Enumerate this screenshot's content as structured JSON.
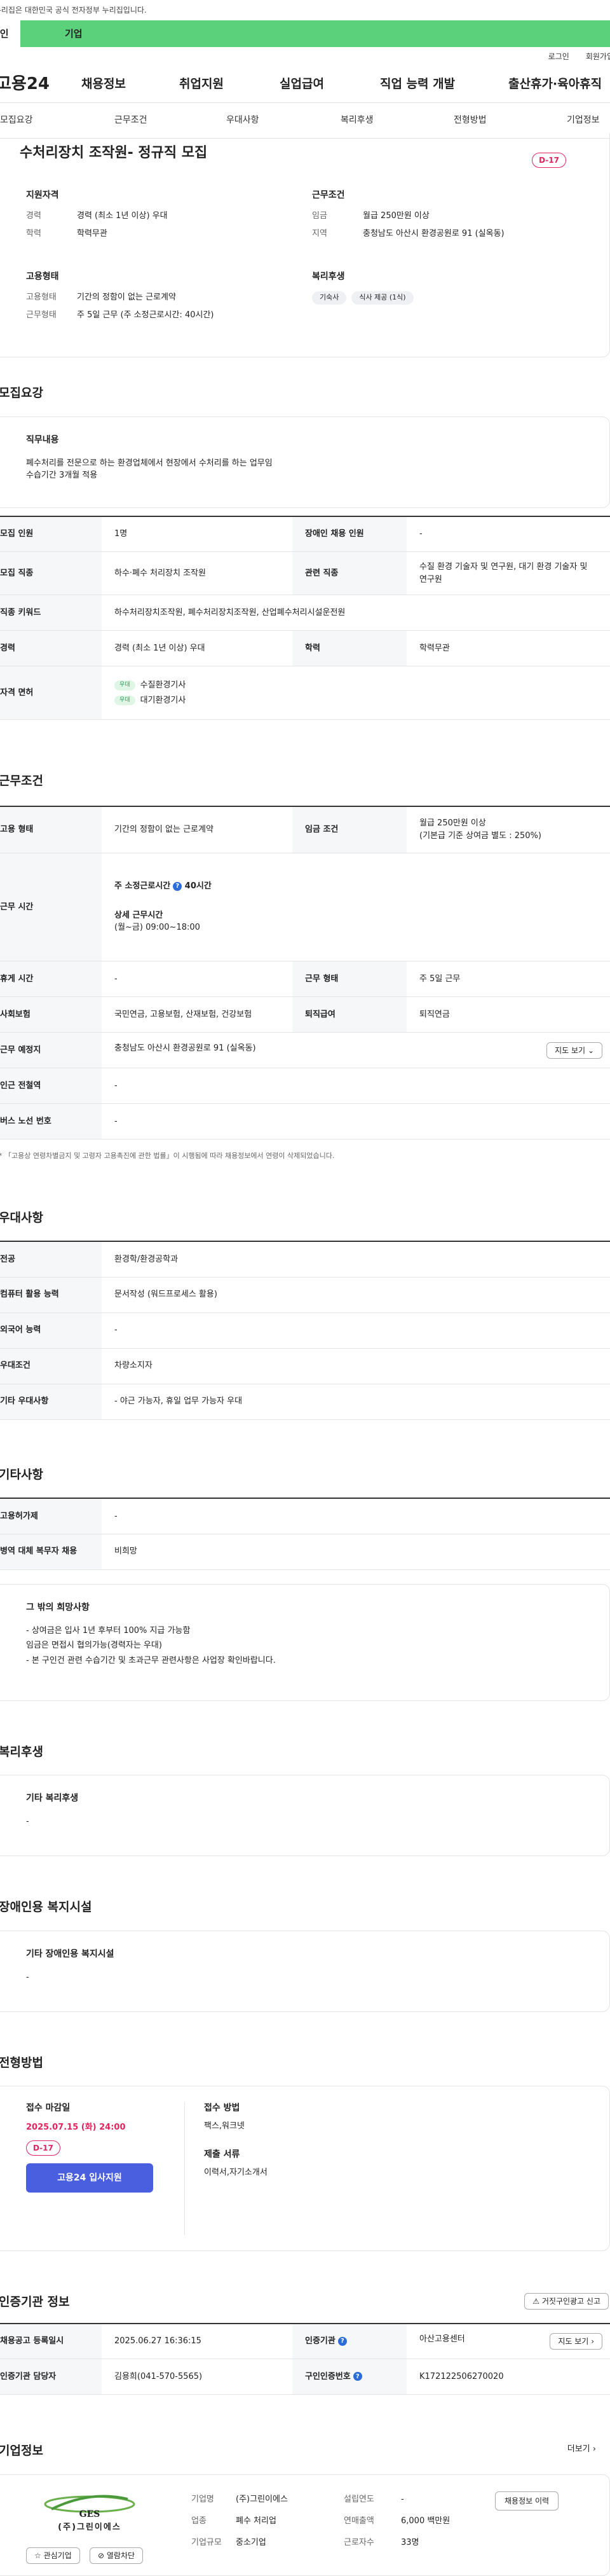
{
  "topbar": {
    "notice": "이 누리집은 대한민국 공식 전자정부 누리집입니다.",
    "tab_person": "개인",
    "tab_company": "기업"
  },
  "util": {
    "login": "로그인",
    "join": "회원가입"
  },
  "gnb": {
    "logo": "고용24",
    "items": [
      "채용정보",
      "취업지원",
      "실업급여",
      "직업 능력 개발",
      "출산휴가·육아휴직"
    ]
  },
  "subnav": [
    "모집요강",
    "근무조건",
    "우대사항",
    "복리후생",
    "전형방법",
    "기업정보"
  ],
  "summary": {
    "title": "수처리장치 조작원- 정규직 모집",
    "dday": "D-17",
    "req_h": "지원자격",
    "career_k": "경력",
    "career_v": "경력 (최소 1년 이상) 우대",
    "edu_k": "학력",
    "edu_v": "학력무관",
    "cond_h": "근무조건",
    "pay_k": "임금",
    "pay_v": "월급 250만원 이상",
    "area_k": "지역",
    "area_v": "충청남도 아산시 환경공원로 91 (실옥동)",
    "emp_h": "고용형태",
    "type_k": "고용형태",
    "type_v": "기간의 정함이 없는 근로계약",
    "hours_k": "근무형태",
    "hours_v": "주 5일 근무 (주 소정근로시간: 40시간)",
    "wel_h": "복리후생",
    "chips": [
      "기숙사",
      "식사 제공 (1식)"
    ]
  },
  "recruit": {
    "title": "모집요강",
    "duty_h": "직무내용",
    "duty_lines": [
      "폐수처리를 전문으로 하는 환경업체에서 현장에서 수처리를 하는 업무임",
      "수습기간 3개월 적용"
    ],
    "rows": {
      "count_k": "모집 인원",
      "count_v": "1명",
      "dis_k": "장애인 채용 인원",
      "dis_v": "-",
      "job_k": "모집 직종",
      "job_v": "하수·폐수 처리장치 조작원",
      "rel_k": "관련 직종",
      "rel_v": "수질 환경 기술자 및 연구원, 대기 환경 기술자 및 연구원",
      "kw_k": "직종 키워드",
      "kw_v": "하수처리장치조작원, 폐수처리장치조작원, 산업폐수처리시설운전원",
      "car_k": "경력",
      "car_v": "경력 (최소 1년 이상) 우대",
      "edu_k": "학력",
      "edu_v": "학력무관",
      "lic_k": "자격 면허",
      "lic_tag": "우대",
      "lic_1": "수질환경기사",
      "lic_2": "대기환경기사"
    }
  },
  "work": {
    "title": "근무조건",
    "type_k": "고용 형태",
    "type_v": "기간의 정함이 없는 근로계약",
    "pay_k": "임금 조건",
    "pay_v1": "월급 250만원 이상",
    "pay_v2": "(기본급 기준 상여금 별도 : 250%)",
    "time_k": "근무 시간",
    "time_v1": "주 소정근로시간",
    "time_v1b": "40시간",
    "time_v2": "상세 근무시간",
    "time_v3": "(월~금) 09:00~18:00",
    "rest_k": "휴게 시간",
    "rest_v": "-",
    "form_k": "근무 형태",
    "form_v": "주 5일 근무",
    "ins_k": "사회보험",
    "ins_v": "국민연금, 고용보험, 산재보험, 건강보험",
    "ret_k": "퇴직급여",
    "ret_v": "퇴직연금",
    "loc_k": "근무 예정지",
    "loc_v": "충청남도 아산시 환경공원로 91 (실옥동)",
    "map_btn": "지도 보기",
    "sub_k": "인근 전철역",
    "sub_v": "-",
    "bus_k": "버스 노선 번호",
    "bus_v": "-",
    "note": "* 「고용상 연령차별금지 및 고령자 고용촉진에 관한 법률」이 시행됨에 따라 채용정보에서 연령이 삭제되었습니다."
  },
  "pref": {
    "title": "우대사항",
    "maj_k": "전공",
    "maj_v": "환경학/환경공학과",
    "pc_k": "컴퓨터 활용 능력",
    "pc_v": "문서작성 (워드프로세스 활용)",
    "lang_k": "외국어 능력",
    "lang_v": "-",
    "cond_k": "우대조건",
    "cond_v": "차량소지자",
    "etc_k": "기타 우대사항",
    "etc_v": "- 야근 가능자, 휴일 업무 가능자 우대"
  },
  "other": {
    "title": "기타사항",
    "dev_k": "고용허가제",
    "dev_v": "-",
    "mil_k": "병역 대체 복무자 채용",
    "mil_v": "비희망",
    "wish_h": "그 밖의 희망사항",
    "wish": [
      "- 상여금은 입사 1년 후부터 100% 지급 가능함",
      "임금은 면접시 협의가능(경력자는 우대)",
      "- 본 구인건 관련 수습기간 및 초과근무 관련사항은 사업장 확인바랍니다."
    ]
  },
  "welfare": {
    "title": "복리후생",
    "h": "기타 복리후생",
    "v": "-"
  },
  "dis": {
    "title": "장애인용 복지시설",
    "h": "기타 장애인용 복지시설",
    "v": "-"
  },
  "apply": {
    "title": "전형방법",
    "dl_h": "접수 마감일",
    "dl_v": "2025.07.15 (화) 24:00",
    "dday": "D-17",
    "btn": "고용24 입사지원",
    "how_h": "접수 방법",
    "how_v": "팩스,워크넷",
    "doc_h": "제출 서류",
    "doc_v": "이력서,자기소개서"
  },
  "cert": {
    "title": "인증기관 정보",
    "report": "거짓구인광고 신고",
    "date_k": "채용공고 등록일시",
    "date_v": "2025.06.27 16:36:15",
    "org_k": "인증기관",
    "org_v": "아산고용센터",
    "map_btn": "지도 보기",
    "mgr_k": "인증기관 담당자",
    "mgr_v": "김용희(041-570-5565)",
    "num_k": "구인인증번호",
    "num_v": "K172122506270020"
  },
  "company": {
    "title": "기업정보",
    "more": "더보기",
    "logo_text": "GES",
    "logo_sub": "(주)그린이에스",
    "name_k": "기업명",
    "name_v": "(주)그린이에스",
    "ind_k": "업종",
    "ind_v": "폐수 처리업",
    "size_k": "기업규모",
    "size_v": "중소기업",
    "year_k": "설립연도",
    "year_v": "-",
    "sales_k": "연매출액",
    "sales_v": "6,000 백만원",
    "emp_k": "근로자수",
    "emp_v": "33명",
    "hist_btn": "채용정보 이력",
    "fav_btn": "관심기업",
    "block_btn": "열람차단"
  }
}
